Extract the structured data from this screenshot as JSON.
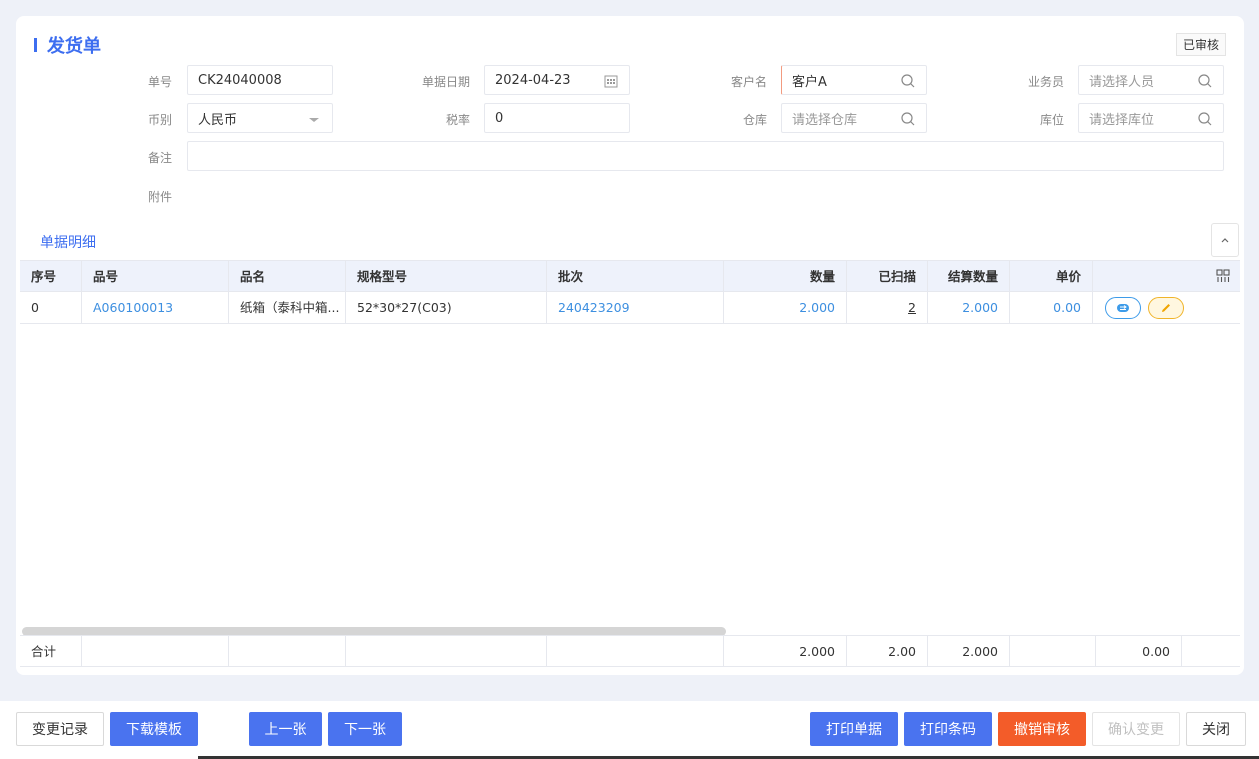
{
  "header": {
    "title": "发货单",
    "status_badge": "已审核"
  },
  "form": {
    "order_no": {
      "label": "单号",
      "value": "CK24040008"
    },
    "doc_date": {
      "label": "单据日期",
      "value": "2024-04-23"
    },
    "customer": {
      "label": "客户名",
      "value": "客户A"
    },
    "salesman": {
      "label": "业务员",
      "placeholder": "请选择人员"
    },
    "currency": {
      "label": "币别",
      "value": "人民币"
    },
    "tax_rate": {
      "label": "税率",
      "value": "0"
    },
    "warehouse": {
      "label": "仓库",
      "placeholder": "请选择仓库"
    },
    "location": {
      "label": "库位",
      "placeholder": "请选择库位"
    },
    "remark": {
      "label": "备注",
      "value": ""
    },
    "attachment": {
      "label": "附件"
    }
  },
  "tabs": [
    {
      "label": "单据明细",
      "active": true
    }
  ],
  "table": {
    "columns": [
      "序号",
      "品号",
      "品名",
      "规格型号",
      "批次",
      "数量",
      "已扫描",
      "结算数量",
      "单价"
    ],
    "rows": [
      {
        "seq": "0",
        "item_no": "A060100013",
        "item_name": "纸箱（泰科中箱...",
        "spec": "52*30*27(C03)",
        "batch": "240423209",
        "qty": "2.000",
        "scanned": "2",
        "settle_qty": "2.000",
        "price": "0.00"
      }
    ],
    "footer": {
      "label": "合计",
      "qty": "2.000",
      "scanned": "2.00",
      "settle_qty": "2.000",
      "price": "0.00"
    }
  },
  "buttons": {
    "change_log": "变更记录",
    "download_template": "下载模板",
    "prev": "上一张",
    "next": "下一张",
    "print_doc": "打印单据",
    "print_barcode": "打印条码",
    "revoke_audit": "撤销审核",
    "confirm_change": "确认变更",
    "close": "关闭"
  },
  "colors": {
    "accent": "#3d6ef0",
    "primary_button": "#4a73ef",
    "danger_button": "#f35c29",
    "link": "#3d8fe0"
  }
}
